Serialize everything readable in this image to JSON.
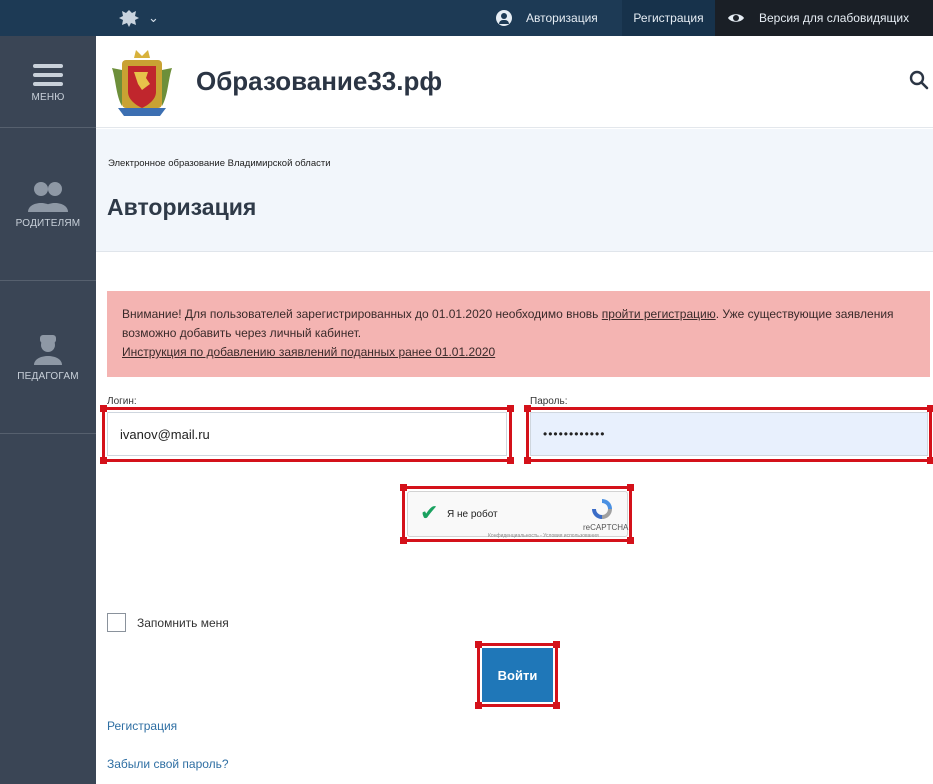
{
  "topbar": {
    "auth_label": "Авторизация",
    "register_label": "Регистрация",
    "vision_label": "Версия для слабовидящих"
  },
  "sidebar": {
    "items": [
      {
        "label": "МЕНЮ",
        "icon": "menu-icon"
      },
      {
        "label": "РОДИТЕЛЯМ",
        "icon": "parents-icon"
      },
      {
        "label": "ПЕДАГОГАМ",
        "icon": "teacher-icon"
      }
    ]
  },
  "header": {
    "site_title": "Образование33.рф"
  },
  "band": {
    "breadcrumb": "Электронное образование Владимирской области",
    "page_title": "Авторизация"
  },
  "notice": {
    "text_before": "Внимание! Для пользователей зарегистрированных до 01.01.2020 необходимо вновь ",
    "link_register": "пройти регистрацию",
    "text_after": ". Уже существующие заявления возможно добавить через личный кабинет.",
    "link_instruction": "Инструкция по добавлению заявлений поданных ранее 01.01.2020"
  },
  "form": {
    "login_label": "Логин:",
    "login_value": "ivanov@mail.ru",
    "password_label": "Пароль:",
    "password_value": "••••••••••••",
    "captcha_text": "Я не робот",
    "captcha_brand": "reCAPTCHA",
    "captcha_small": "Конфиденциальность - Условия использования",
    "remember_label": "Запомнить меня",
    "submit_label": "Войти"
  },
  "links": {
    "register": "Регистрация",
    "forgot": "Забыли свой пароль?"
  },
  "colors": {
    "topbar": "#1d3a55",
    "sidebar": "#3a4555",
    "notice_bg": "#f4b4b2",
    "primary_button": "#1f77b8",
    "highlight_frame": "#d4111a"
  }
}
